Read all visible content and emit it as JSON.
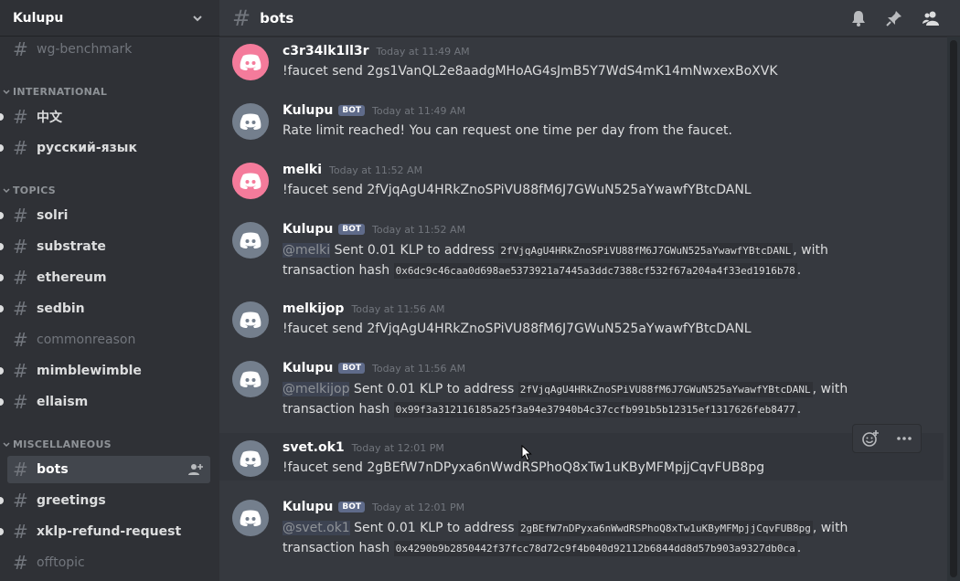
{
  "guild": {
    "name": "Kulupu"
  },
  "sidebar": {
    "top_channels": [
      {
        "name": "wg-benchmark",
        "muted": true
      }
    ],
    "categories": [
      {
        "name": "INTERNATIONAL",
        "channels": [
          {
            "name": "中文"
          },
          {
            "name": "русский-язык"
          }
        ]
      },
      {
        "name": "TOPICS",
        "channels": [
          {
            "name": "solri"
          },
          {
            "name": "substrate"
          },
          {
            "name": "ethereum"
          },
          {
            "name": "sedbin"
          },
          {
            "name": "commonreason",
            "muted": true
          },
          {
            "name": "mimblewimble"
          },
          {
            "name": "ellaism"
          }
        ]
      },
      {
        "name": "MISCELLANEOUS",
        "channels": [
          {
            "name": "bots",
            "active": true
          },
          {
            "name": "greetings"
          },
          {
            "name": "xklp-refund-request"
          },
          {
            "name": "offtopic",
            "muted": true
          }
        ]
      }
    ]
  },
  "channel": {
    "name": "bots"
  },
  "colors": {
    "sidebar_bg": "#2f3136",
    "main_bg": "#36393f",
    "avatar_grey": "#747f8d",
    "avatar_pink": "#f47b9b"
  },
  "messages": [
    {
      "author": "c3r34lk1ll3r",
      "bot": false,
      "time": "Today at 11:49 AM",
      "avatar": "pink",
      "text": "!faucet send 2gs1VanQL2e8aadgMHoAG4sJmB5Y7WdS4mK14mNwxexBoXVK"
    },
    {
      "author": "Kulupu",
      "bot": true,
      "bot_label": "BOT",
      "time": "Today at 11:49 AM",
      "avatar": "grey",
      "text": "Rate limit reached! You can request one time per day from the faucet."
    },
    {
      "author": "melki",
      "bot": false,
      "time": "Today at 11:52 AM",
      "avatar": "pink",
      "text": "!faucet send 2fVjqAgU4HRkZnoSPiVU88fM6J7GWuN525aYwawfYBtcDANL"
    },
    {
      "author": "Kulupu",
      "bot": true,
      "bot_label": "BOT",
      "time": "Today at 11:52 AM",
      "avatar": "grey",
      "mention": "@melki",
      "sent": " Sent 0.01 KLP to address ",
      "address": "2fVjqAgU4HRkZnoSPiVU88fM6J7GWuN525aYwawfYBtcDANL",
      "with": ", with",
      "hash_label": "transaction hash ",
      "hash": "0x6dc9c46caa0d698ae5373921a7445a3ddc7388cf532f67a204a4f33ed1916b78",
      "end": "."
    },
    {
      "author": "melkijop",
      "bot": false,
      "time": "Today at 11:56 AM",
      "avatar": "grey",
      "text": "!faucet send 2fVjqAgU4HRkZnoSPiVU88fM6J7GWuN525aYwawfYBtcDANL"
    },
    {
      "author": "Kulupu",
      "bot": true,
      "bot_label": "BOT",
      "time": "Today at 11:56 AM",
      "avatar": "grey",
      "mention": "@melkijop",
      "sent": " Sent 0.01 KLP to address ",
      "address": "2fVjqAgU4HRkZnoSPiVU88fM6J7GWuN525aYwawfYBtcDANL",
      "with": ", with",
      "hash_label": "transaction hash ",
      "hash": "0x99f3a312116185a25f3a94e37940b4c37ccfb991b5b12315ef1317626feb8477",
      "end": "."
    },
    {
      "author": "svet.ok1",
      "bot": false,
      "time": "Today at 12:01 PM",
      "avatar": "grey",
      "text": "!faucet send 2gBEfW7nDPyxa6nWwdRSPhoQ8xTw1uKByMFMpjjCqvFUB8pg"
    },
    {
      "author": "Kulupu",
      "bot": true,
      "bot_label": "BOT",
      "time": "Today at 12:01 PM",
      "avatar": "grey",
      "mention": "@svet.ok1",
      "sent": " Sent 0.01 KLP to address ",
      "address": "2gBEfW7nDPyxa6nWwdRSPhoQ8xTw1uKByMFMpjjCqvFUB8pg",
      "with": ", with",
      "hash_label": "transaction hash ",
      "hash": "0x4290b9b2850442f37fcc78d72c9f4b040d92112b6844dd8d57b903a9327db0ca",
      "end": "."
    }
  ],
  "icons": {
    "header": [
      "bell-icon",
      "pin-icon",
      "members-icon"
    ],
    "toolbar": [
      "add-reaction-icon",
      "more-options-icon"
    ]
  }
}
